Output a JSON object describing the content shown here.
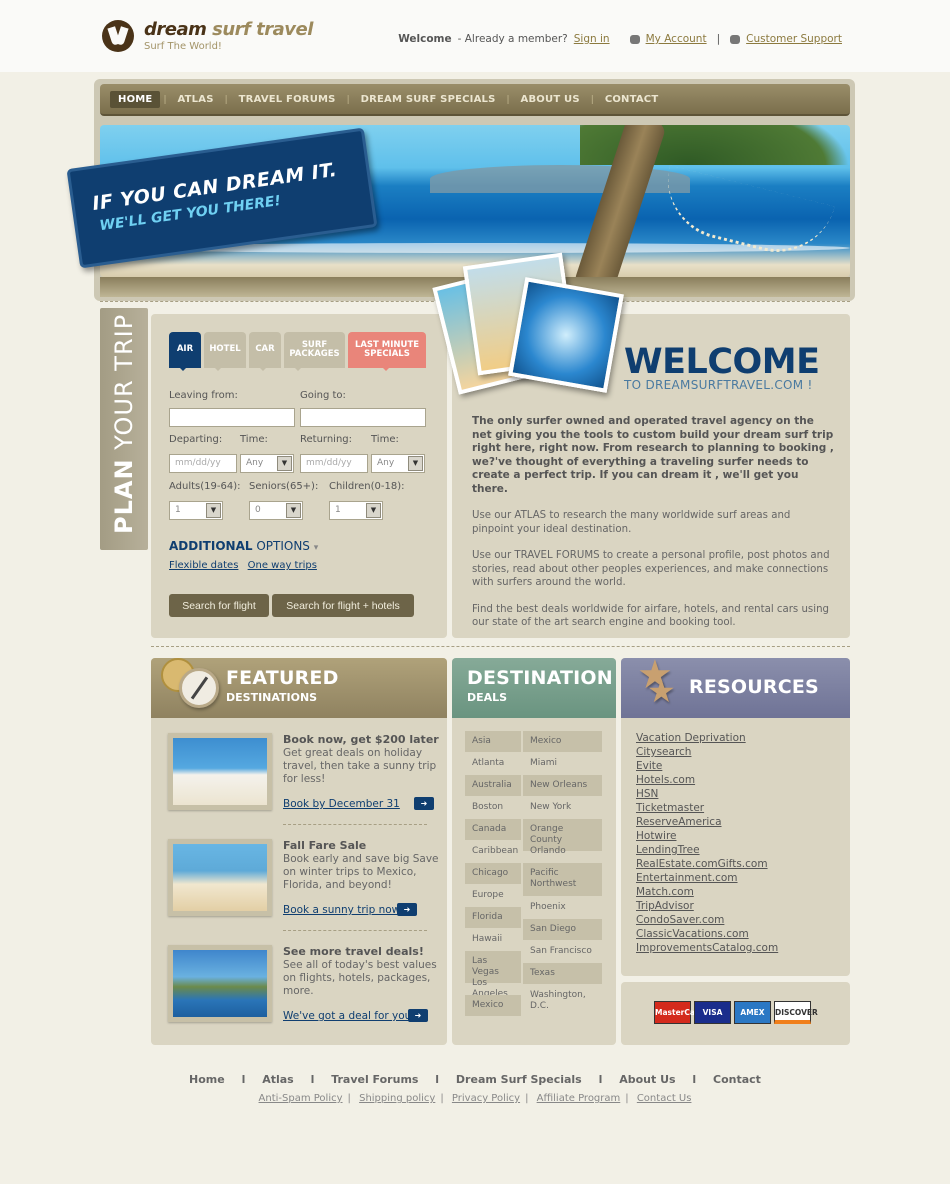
{
  "brand": {
    "name_a": "dream ",
    "name_b": "surf travel",
    "tagline": "Surf The World!"
  },
  "topbar": {
    "welcome": "Welcome",
    "member_text": "- Already a member?",
    "sign_in": "Sign in",
    "my_account": "My Account",
    "sep": "|",
    "support": "Customer Support"
  },
  "nav": {
    "items": [
      "HOME",
      "ATLAS",
      "TRAVEL FORUMS",
      "DREAM SURF SPECIALS",
      "ABOUT US",
      "CONTACT"
    ],
    "divider": "|"
  },
  "banner": {
    "line1": "IF YOU CAN DREAM IT.",
    "line2": "WE'LL GET YOU THERE!"
  },
  "plan": {
    "bold": "PLAN",
    "rest": " YOUR TRIP"
  },
  "search": {
    "tabs": {
      "air": "AIR",
      "hotel": "HOTEL",
      "car": "CAR",
      "surf": "SURF PACKAGES",
      "last": "LAST MINUTE SPECIALS"
    },
    "leaving_label": "Leaving from:",
    "going_label": "Going to:",
    "departing_label": "Departing:",
    "time_label": "Time:",
    "returning_label": "Returning:",
    "date_placeholder": "mm/dd/yy",
    "time_value": "Any",
    "adults_label": "Adults(19-64):",
    "seniors_label": "Seniors(65+):",
    "children_label": "Children(0-18):",
    "adults_value": "1",
    "seniors_value": "0",
    "children_value": "1",
    "additional_bold": "ADDITIONAL",
    "additional_rest": " OPTIONS",
    "flexible": "Flexible dates",
    "oneway": "One way trips",
    "btn_flight": "Search for flight",
    "btn_flight_hotels": "Search for flight + hotels",
    "dropdown_arrow": "▼",
    "caret": "▾"
  },
  "welcome": {
    "title": "WELCOME",
    "subtitle": "TO DREAMSURFTRAVEL.COM !",
    "lead": "The only surfer owned and operated travel agency on the net giving you the tools to custom build your dream surf trip right here, right now. From research to planning to booking , we?'ve thought of everything a traveling surfer needs to create a perfect trip.  If you can dream it , we'll get you there.",
    "p1": "Use our ATLAS to research the many worldwide surf areas and pinpoint your ideal destination.",
    "p2": "Use our TRAVEL FORUMS to create a personal profile, post photos and stories, read about other peoples experiences, and make connections with surfers around the world.",
    "p3": "Find the best deals worldwide for airfare, hotels, and rental cars using our state of the art search engine and booking tool."
  },
  "featured": {
    "h1": "FEATURED",
    "h2": "DESTINATIONS",
    "items": [
      {
        "title": "Book now, get $200 later",
        "desc": "Get great deals on holiday travel, then take a sunny trip for less!",
        "link": "Book by December 31"
      },
      {
        "title": "Fall Fare Sale",
        "desc": "Book early and save big Save on winter trips to Mexico, Florida, and beyond!",
        "link": "Book a sunny trip now"
      },
      {
        "title": "See more travel deals!",
        "desc": "See all of today's best values on flights, hotels, packages, more.",
        "link": "We've got a deal for you"
      }
    ],
    "arrow": "➜"
  },
  "destination": {
    "h1": "DESTINATION",
    "h2": "DEALS",
    "left": [
      "Asia",
      "Atlanta",
      "Australia",
      "Boston",
      "Canada",
      "Caribbean",
      "Chicago",
      "Europe",
      "Florida",
      "Hawaii",
      "Las Vegas",
      "Los Angeles",
      "Mexico"
    ],
    "right": [
      "Mexico",
      "Miami",
      "New Orleans",
      "New York",
      "Orange County",
      "Orlando",
      "Pacific Northwest",
      "Phoenix",
      "San Diego",
      "San Francisco",
      "Texas",
      "Washington, D.C."
    ]
  },
  "resources": {
    "title": "RESOURCES",
    "links": [
      "Vacation Deprivation",
      "Citysearch",
      "Evite",
      "Hotels.com",
      "HSN",
      "Ticketmaster",
      "ReserveAmerica ",
      "Hotwire",
      "LendingTree",
      "RealEstate.comGifts.com",
      "Entertainment.com",
      "Match.com",
      "TripAdvisor",
      "CondoSaver.com ",
      "ClassicVacations.com",
      "ImprovementsCatalog.com"
    ],
    "star": "★"
  },
  "payments": [
    "MasterCard",
    "VISA",
    "AMEX",
    "DISCOVER"
  ],
  "colors": {
    "mastercard": "#d42a1c",
    "visa": "#1a2d8c",
    "amex": "#2b78c4",
    "discover": "#f07f1a"
  },
  "footer": {
    "main": [
      "Home",
      "Atlas",
      "Travel Forums",
      "Dream Surf Specials",
      "About Us",
      "Contact"
    ],
    "main_sep": "l",
    "sub": [
      "Anti-Spam Policy",
      "Shipping policy",
      "Privacy Policy",
      "Affiliate Program",
      "Contact Us"
    ],
    "sub_sep": "|"
  }
}
